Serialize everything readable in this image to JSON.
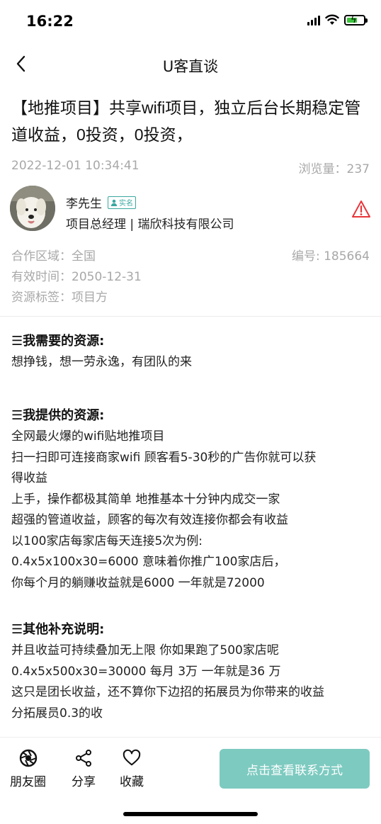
{
  "status_bar": {
    "time": "16:22"
  },
  "nav": {
    "title": "U客直谈"
  },
  "post": {
    "title": "【地推项目】共享wifi项目，独立后台长期稳定管道收益，0投资，0投资，",
    "date": "2022-12-01 10:34:41",
    "views": "浏览量：237"
  },
  "author": {
    "name": "李先生",
    "badge": "实名",
    "description": "项目总经理 | 瑞欣科技有限公司"
  },
  "info": {
    "region": "合作区域：全国",
    "id_number": "编号: 185664",
    "valid_until": "有效时间：2050-12-31",
    "tag": "资源标签：项目方"
  },
  "sections": {
    "need": {
      "title": "☰我需要的资源:",
      "lines": [
        "想挣钱，想一劳永逸，有团队的来"
      ]
    },
    "offer": {
      "title": "☰我提供的资源:",
      "lines": [
        "全网最火爆的wifi贴地推项目",
        "扫一扫即可连接商家wifi 顾客看5-30秒的广告你就可以获",
        "得收益",
        "上手，操作都极其简单 地推基本十分钟内成交一家",
        "超强的管道收益，顾客的每次有效连接你都会有收益",
        "以100家店每家店每天连接5次为例:",
        "0.4x5x100x30=6000 意味着你推广100家店后，",
        "你每个月的躺赚收益就是6000 一年就是72000"
      ]
    },
    "other": {
      "title": "☰其他补充说明:",
      "lines": [
        "并且收益可持续叠加无上限 你如果跑了500家店呢",
        "0.4x5x500x30=30000 每月 3万 一年就是36 万",
        "这只是团长收益，还不算你下边招的拓展员为你带来的收益",
        "分拓展员0.3的收"
      ]
    }
  },
  "bottom_bar": {
    "moments_label": "朋友圈",
    "share_label": "分享",
    "favorite_label": "收藏",
    "contact_label": "点击查看联系方式",
    "contact_color": "#7dcac0"
  },
  "icons": {
    "back": "chevron-left-icon",
    "report": "warning-triangle-icon",
    "moments": "camera-aperture-icon",
    "share": "share-icon",
    "favorite": "heart-icon"
  }
}
